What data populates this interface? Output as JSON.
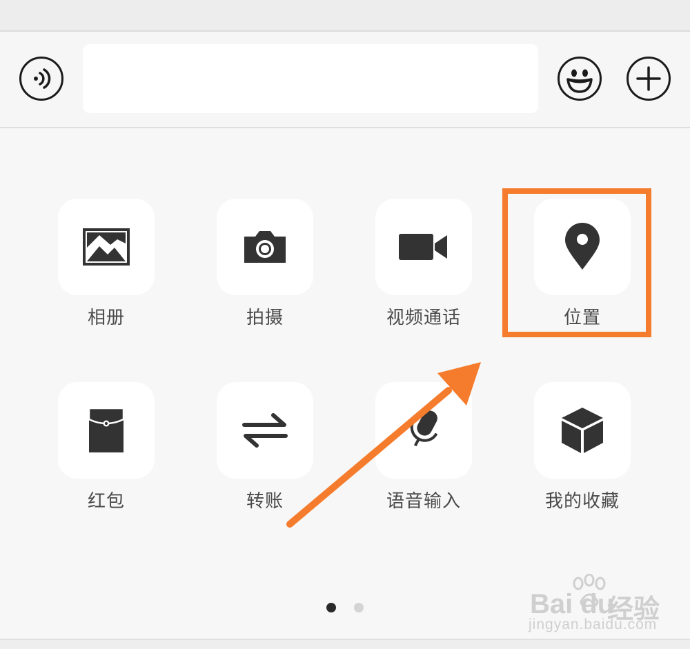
{
  "input_bar": {
    "message_value": "",
    "message_placeholder": ""
  },
  "icons": {
    "voice": "voice-icon",
    "emoji": "emoji-icon",
    "plus": "plus-icon"
  },
  "actions": [
    {
      "label": "相册",
      "icon": "photo-album-icon"
    },
    {
      "label": "拍摄",
      "icon": "camera-icon"
    },
    {
      "label": "视频通话",
      "icon": "video-call-icon"
    },
    {
      "label": "位置",
      "icon": "location-pin-icon"
    },
    {
      "label": "红包",
      "icon": "red-packet-icon"
    },
    {
      "label": "转账",
      "icon": "transfer-icon"
    },
    {
      "label": "语音输入",
      "icon": "microphone-icon"
    },
    {
      "label": "我的收藏",
      "icon": "favorites-box-icon"
    }
  ],
  "pager": {
    "page_count": 2,
    "current_page": 1
  },
  "annotation": {
    "highlight_color": "#f47c2c",
    "highlighted_action": "位置"
  },
  "watermark": {
    "logo": "Bai du",
    "brand": "经验",
    "url": "jingyan.baidu.com"
  },
  "colors": {
    "icon": "#333333",
    "label": "#4a4a4a",
    "panel_bg": "#f7f7f7",
    "tile_bg": "#ffffff"
  }
}
